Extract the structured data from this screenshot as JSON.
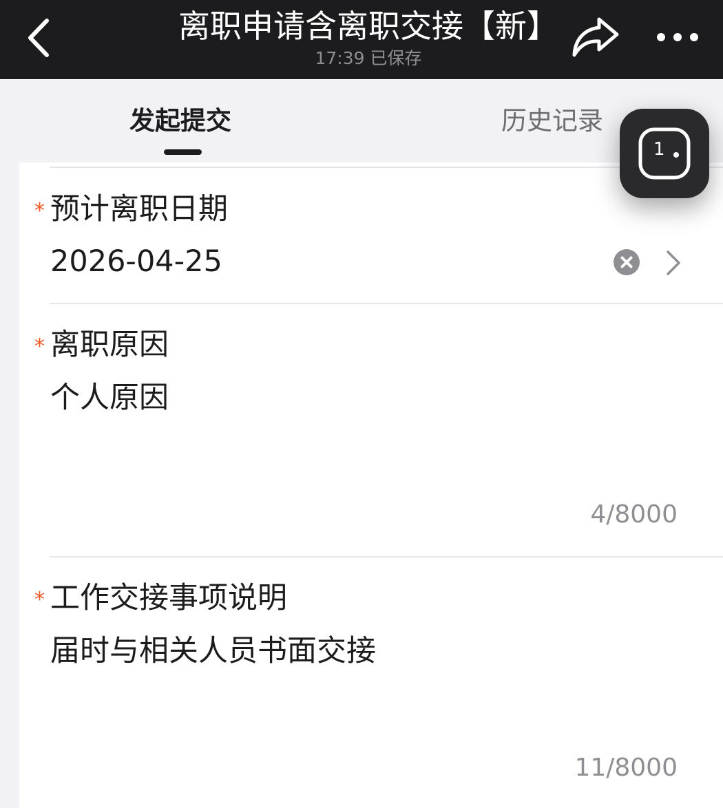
{
  "header": {
    "title": "离职申请含离职交接【新】",
    "subtitle": "17:39 已保存",
    "back_icon": "chevron-left-icon",
    "share_icon": "share-icon",
    "more_icon": "more-icon"
  },
  "tabs": [
    {
      "label": "发起提交",
      "active": true
    },
    {
      "label": "历史记录",
      "active": false
    }
  ],
  "floating_widget": {
    "icon": "float-window-icon",
    "text": "1"
  },
  "form": {
    "required_mark": "*",
    "fields": [
      {
        "label": "预计离职日期",
        "value": "2026-04-25",
        "type": "date-picker",
        "clear_icon": "clear-icon",
        "chevron_icon": "chevron-right-icon"
      },
      {
        "label": "离职原因",
        "value": "个人原因",
        "type": "textarea",
        "counter": "4/8000"
      },
      {
        "label": "工作交接事项说明",
        "value": "届时与相关人员书面交接",
        "type": "textarea",
        "counter": "11/8000"
      }
    ]
  },
  "colors": {
    "header_bg": "#1c1c1e",
    "page_bg": "#f2f2f6",
    "required": "#f05a28",
    "muted": "#8e8e93"
  }
}
